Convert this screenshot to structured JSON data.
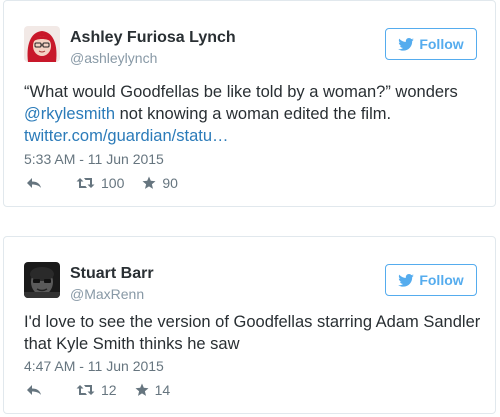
{
  "colors": {
    "accent": "#55acee",
    "link": "#2b7bb9",
    "muted": "#8899a6",
    "text": "#292f33",
    "border": "#e1e8ed"
  },
  "tweets": [
    {
      "name": "Ashley Furiosa Lynch",
      "handle": "@ashleylynch",
      "follow_label": "Follow",
      "text_a": "“What would Goodfellas be like told by a woman?” wonders",
      "mention": "@rkylesmith",
      "text_b": " not knowing a woman edited the film.",
      "link": "twitter.com/guardian/statu…",
      "timestamp": "5:33 AM - 11 Jun 2015",
      "retweets": "100",
      "favorites": "90",
      "avatar_icon": "red-hair-cartoon-avatar"
    },
    {
      "name": "Stuart Barr",
      "handle": "@MaxRenn",
      "follow_label": "Follow",
      "text_line1": "I'd love to see the version of Goodfellas starring Adam Sandler",
      "text_line2": "that Kyle Smith thinks he saw",
      "timestamp": "4:47 AM - 11 Jun 2015",
      "retweets": "12",
      "favorites": "14",
      "avatar_icon": "grayscale-photo-avatar"
    }
  ]
}
